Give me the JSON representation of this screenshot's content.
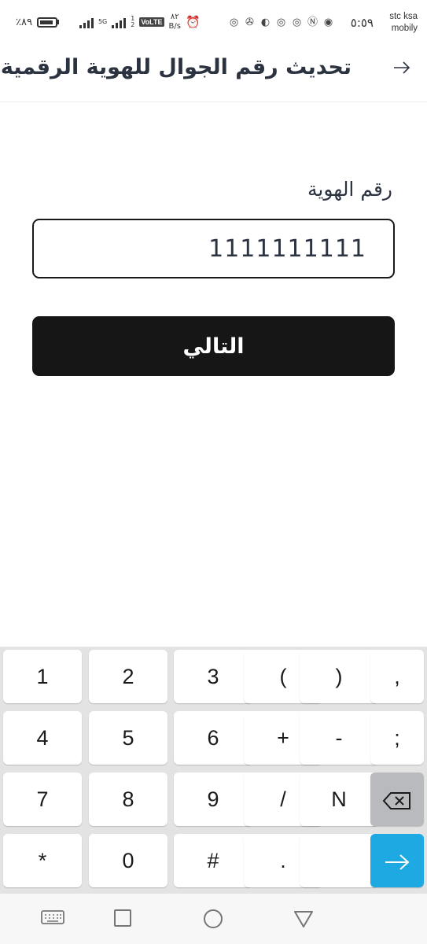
{
  "status_bar": {
    "carrier_line1": "stc ksa",
    "carrier_line2": "mobily",
    "time": "٥:٥٩",
    "battery_percent": "٪٨٩",
    "speed_value": "٨٢",
    "speed_unit": "B/s",
    "volte_label": "VoLTE",
    "net_5g": "5G",
    "sim_1": "1",
    "sim_2": "2",
    "icons": [
      "whatsapp-icon",
      "nfc-icon",
      "eye-icon",
      "whatsapp-icon",
      "whatsapp-icon",
      "dark-mode-icon",
      "share-icon",
      "alarm-icon"
    ]
  },
  "header": {
    "title": "تحديث رقم الجوال للهوية الرقمية",
    "back_icon": "arrow-right-icon"
  },
  "form": {
    "id_label": "رقم الهوية",
    "id_value": "1111111111",
    "next_label": "التالي"
  },
  "keyboard": {
    "rows": [
      [
        "1",
        "2",
        "3",
        "(",
        ")",
        ","
      ],
      [
        "4",
        "5",
        "6",
        "+",
        "-",
        ";"
      ],
      [
        "7",
        "8",
        "9",
        "/",
        "N",
        ""
      ],
      [
        "*",
        "0",
        "#",
        ".",
        "",
        ""
      ]
    ],
    "backspace_icon": "backspace-icon",
    "enter_icon": "enter-arrow-icon",
    "accent_color": "#1ea9e3"
  },
  "navbar": {
    "icons": [
      "keyboard-icon",
      "recent-apps-icon",
      "home-icon",
      "back-icon"
    ]
  }
}
